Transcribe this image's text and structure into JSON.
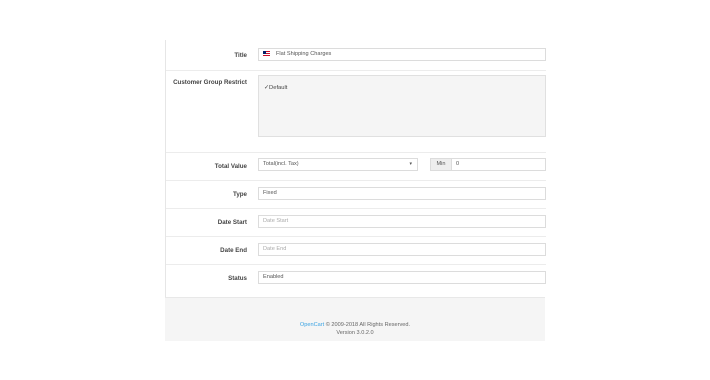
{
  "form": {
    "title": {
      "label": "Title",
      "value": "Flat Shipping Charges"
    },
    "customer_group": {
      "label": "Customer Group Restrict",
      "option": "Default",
      "checked": true
    },
    "total_value": {
      "label": "Total Value",
      "selected": "Total(incl. Tax)",
      "addon": "Min",
      "min_value": "0"
    },
    "type": {
      "label": "Type",
      "value": "Fixed"
    },
    "date_start": {
      "label": "Date Start",
      "placeholder": "Date Start"
    },
    "date_end": {
      "label": "Date End",
      "placeholder": "Date End"
    },
    "status": {
      "label": "Status",
      "value": "Enabled"
    }
  },
  "footer": {
    "link_text": "OpenCart",
    "copyright": " © 2009-2018 All Rights Reserved.",
    "version": "Version 3.0.2.0"
  },
  "icons": {
    "flag": "uk-flag-icon",
    "check": "checkmark-icon",
    "caret": "caret-down-icon"
  }
}
